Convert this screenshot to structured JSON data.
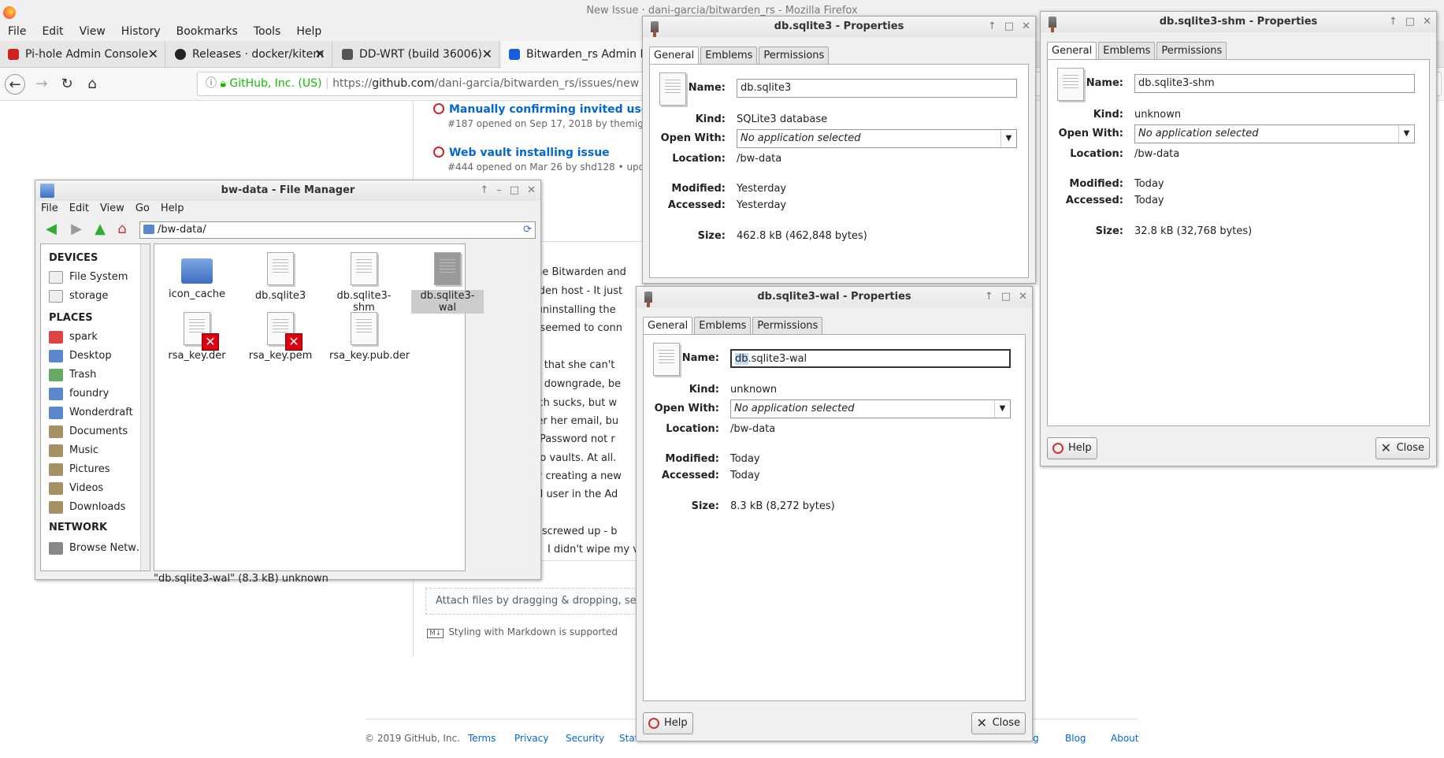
{
  "firefox": {
    "title": "New Issue · dani-garcia/bitwarden_rs - Mozilla Firefox",
    "menu": [
      "File",
      "Edit",
      "View",
      "History",
      "Bookmarks",
      "Tools",
      "Help"
    ],
    "tabs": [
      {
        "label": "Pi-hole Admin Console",
        "color": "#cc2222"
      },
      {
        "label": "Releases · docker/kitem",
        "color": "#222222"
      },
      {
        "label": "DD-WRT (build 36006) -",
        "color": "#555555"
      },
      {
        "label": "Bitwarden_rs Admin Pa",
        "color": "#175ddc"
      }
    ],
    "url": {
      "security": "GitHub, Inc. (US)",
      "prefix": "https://",
      "host": "github.com",
      "path": "/dani-garcia/bitwarden_rs/issues/new"
    }
  },
  "github": {
    "issues": [
      {
        "title": "Manually confirming invited users w",
        "meta": "#187 opened on Sep 17, 2018 by themightycl"
      },
      {
        "title": "Web vault installing issue",
        "meta": "#444 opened on Mar 26 by shd128 • updated"
      }
    ],
    "body_lines": [
      "s, the Bitwarden and",
      "warden host - It just",
      "up uninstalling the",
      "hat seemed to conn",
      "ions that she can't",
      "sion downgrade, be",
      "which sucks, but w",
      "enter her email, bu",
      "me/Password not r",
      "re no vaults. At all.",
      "d by creating a new",
      "ered user in the Ad",
      "just screwed up - b",
      "I didn't wipe my va"
    ],
    "attach": "Attach files by dragging & dropping, selectin",
    "markdown": "Styling with Markdown is supported",
    "footer": {
      "copyright": "© 2019 GitHub, Inc.",
      "links": [
        "Terms",
        "Privacy",
        "Security",
        "Stat"
      ],
      "right_links": [
        "g",
        "Blog",
        "About"
      ]
    }
  },
  "file_manager": {
    "title": "bw-data - File Manager",
    "menu": [
      "File",
      "Edit",
      "View",
      "Go",
      "Help"
    ],
    "location": "/bw-data/",
    "sections": [
      {
        "heading": "DEVICES",
        "items": [
          "File System",
          "storage"
        ]
      },
      {
        "heading": "PLACES",
        "items": [
          "spark",
          "Desktop",
          "Trash",
          "foundry",
          "Wonderdraft",
          "Documents",
          "Music",
          "Pictures",
          "Videos",
          "Downloads"
        ]
      },
      {
        "heading": "NETWORK",
        "items": [
          "Browse Netw…"
        ]
      }
    ],
    "files": [
      {
        "name": "icon_cache",
        "type": "folder"
      },
      {
        "name": "db.sqlite3",
        "type": "file"
      },
      {
        "name": "db.sqlite3-shm",
        "type": "file"
      },
      {
        "name": "db.sqlite3-wal",
        "type": "file",
        "selected": true
      },
      {
        "name": "rsa_key.der",
        "type": "locked"
      },
      {
        "name": "rsa_key.pem",
        "type": "locked"
      },
      {
        "name": "rsa_key.pub.der",
        "type": "file"
      }
    ],
    "status": "\"db.sqlite3-wal\" (8.3 kB) unknown"
  },
  "props": {
    "tabs": [
      "General",
      "Emblems",
      "Permissions"
    ],
    "labels": {
      "name": "Name:",
      "kind": "Kind:",
      "open_with": "Open With:",
      "location": "Location:",
      "modified": "Modified:",
      "accessed": "Accessed:",
      "size": "Size:"
    },
    "help": "Help",
    "close": "Close",
    "sqlite3": {
      "title": "db.sqlite3 - Properties",
      "name": "db.sqlite3",
      "kind": "SQLite3 database",
      "open_with": "No application selected",
      "location": "/bw-data",
      "modified": "Yesterday",
      "accessed": "Yesterday",
      "size": "462.8 kB (462,848 bytes)"
    },
    "shm": {
      "title": "db.sqlite3-shm - Properties",
      "name": "db.sqlite3-shm",
      "kind": "unknown",
      "open_with": "No application selected",
      "location": "/bw-data",
      "modified": "Today",
      "accessed": "Today",
      "size": "32.8 kB (32,768 bytes)"
    },
    "wal": {
      "title": "db.sqlite3-wal - Properties",
      "name_sel": "db",
      "name_rest": ".sqlite3-wal",
      "kind": "unknown",
      "open_with": "No application selected",
      "location": "/bw-data",
      "modified": "Today",
      "accessed": "Today",
      "size": "8.3 kB (8,272 bytes)"
    }
  }
}
